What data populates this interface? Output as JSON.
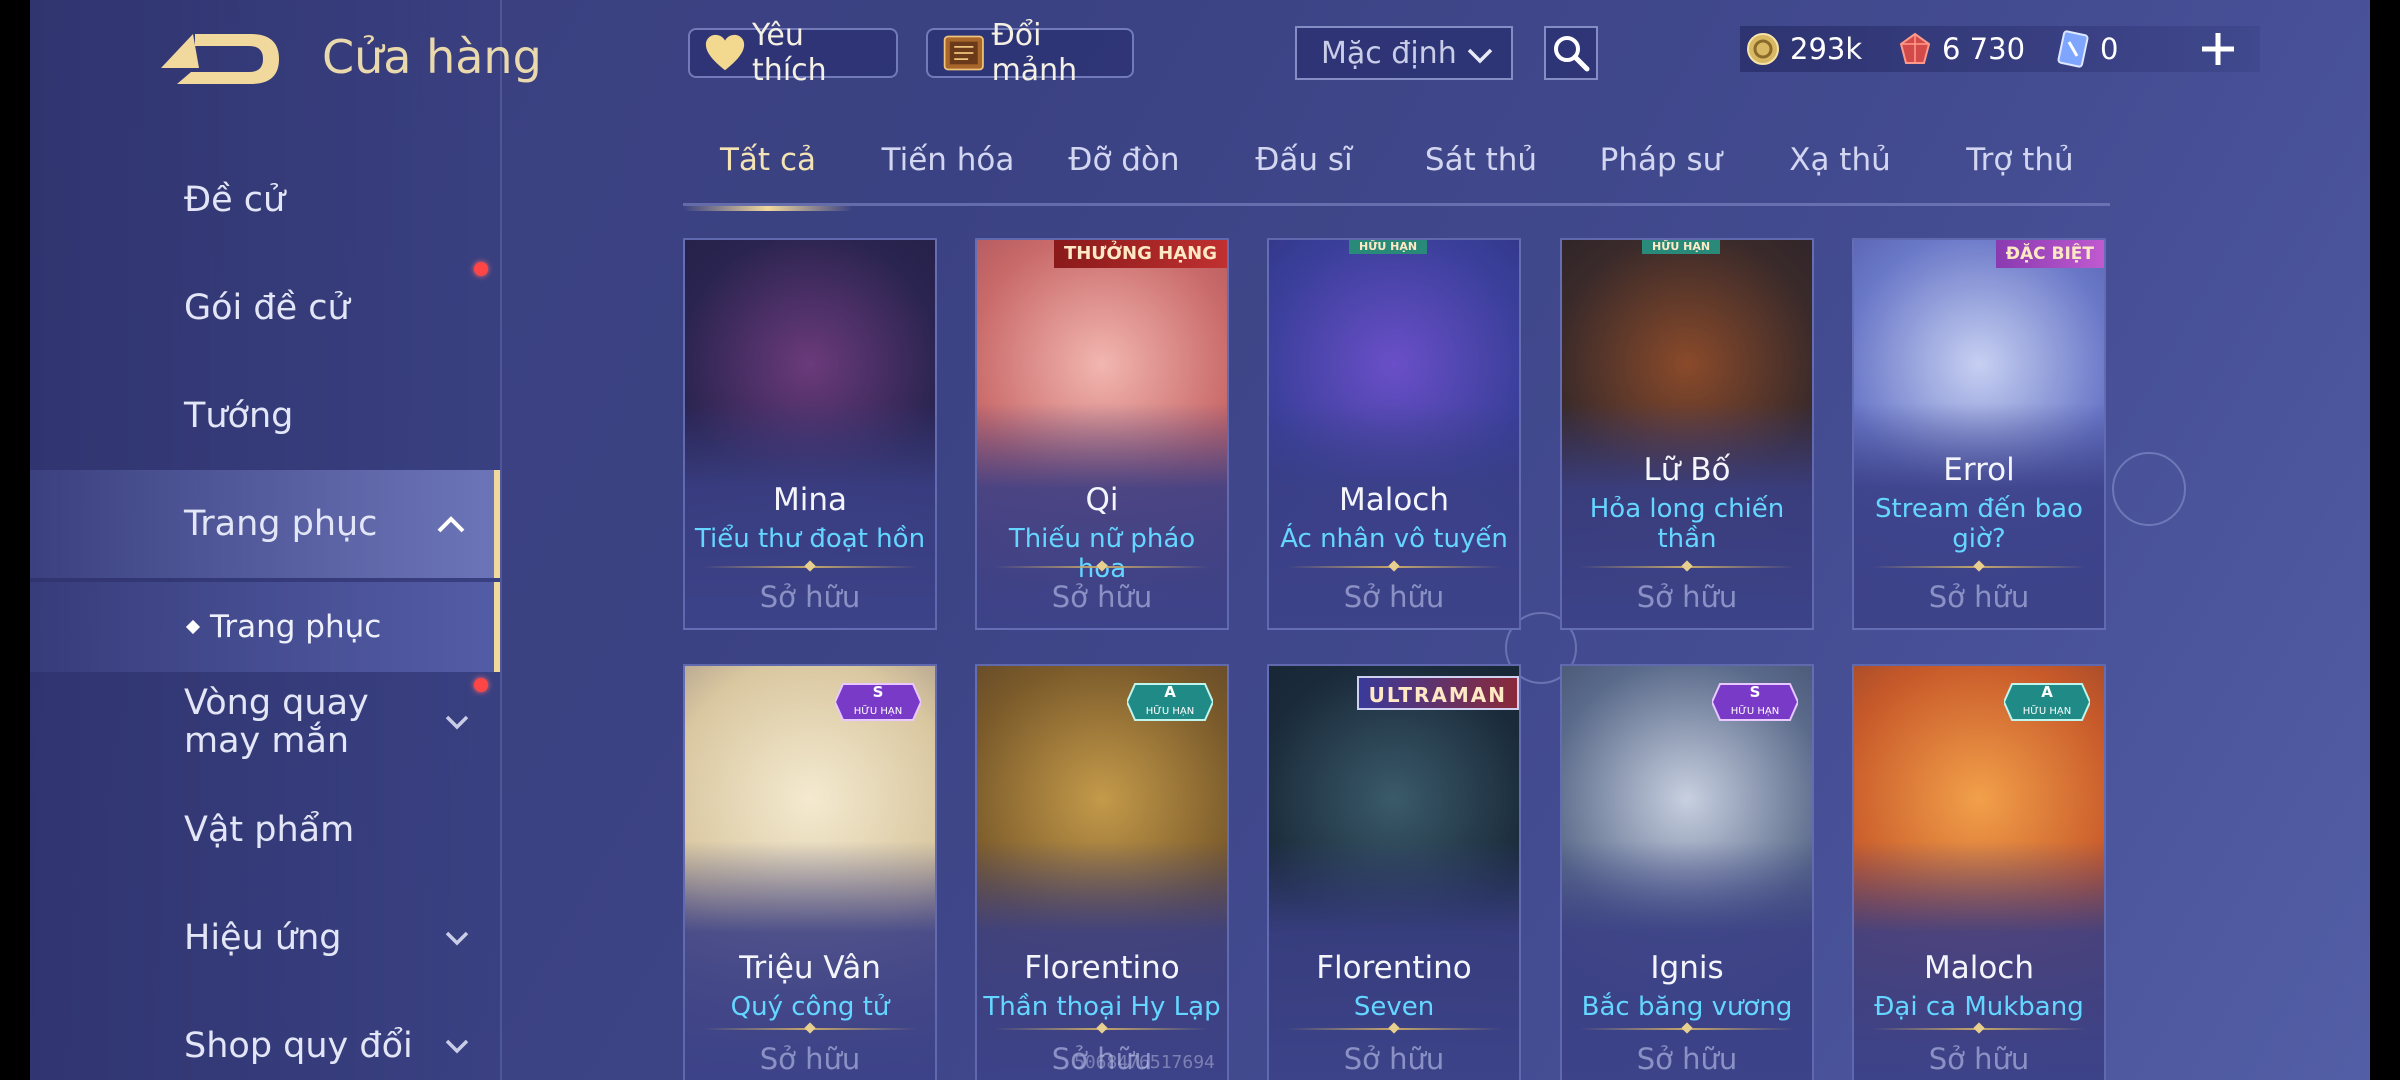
{
  "header": {
    "title": "Cửa hàng"
  },
  "toolbar": {
    "favorites_label": "Yêu thích",
    "exchange_label": "Đổi mảnh",
    "sort_selected": "Mặc định"
  },
  "currencies": [
    {
      "value": "293k",
      "icon": "gold-coin-icon"
    },
    {
      "value": "6 730",
      "icon": "ruby-icon"
    },
    {
      "value": "0",
      "icon": "voucher-card-icon"
    }
  ],
  "sidebar": {
    "items": [
      {
        "label": "Đề cử"
      },
      {
        "label": "Gói đề cử"
      },
      {
        "label": "Tướng"
      },
      {
        "label": "Trang phục"
      },
      {
        "label": "Trang phục"
      },
      {
        "label": "Vòng quay may mắn"
      },
      {
        "label": "Vật phẩm"
      },
      {
        "label": "Hiệu ứng"
      },
      {
        "label": "Shop quy đổi"
      }
    ]
  },
  "tabs": [
    {
      "label": "Tất cả"
    },
    {
      "label": "Tiến hóa"
    },
    {
      "label": "Đỡ đòn"
    },
    {
      "label": "Đấu sĩ"
    },
    {
      "label": "Sát thủ"
    },
    {
      "label": "Pháp sư"
    },
    {
      "label": "Xạ thủ"
    },
    {
      "label": "Trợ thủ"
    }
  ],
  "cards": [
    {
      "hero": "Mina",
      "skin": "Tiểu thư đoạt hồn",
      "status": "Sở hữu",
      "badge": "",
      "colors": [
        "#2a2450",
        "#6b3a7a",
        "#1c1a3a"
      ]
    },
    {
      "hero": "Qi",
      "skin": "Thiếu nữ pháo hoa",
      "status": "Sở hữu",
      "badge": "THƯỞNG HẠNG",
      "colors": [
        "#c96a6a",
        "#f2b6b0",
        "#8a3a4a"
      ]
    },
    {
      "hero": "Maloch",
      "skin": "Ác nhân vô tuyến",
      "status": "Sở hữu",
      "badge": "HỮU HẠN",
      "colors": [
        "#3a3f9a",
        "#6a4fc8",
        "#24286a"
      ]
    },
    {
      "hero": "Lữ Bố",
      "skin": "Hỏa long chiến thần",
      "status": "Sở hữu",
      "badge": "HỮU HẠN",
      "colors": [
        "#3a2a2a",
        "#8a4a2a",
        "#1a1a2a"
      ]
    },
    {
      "hero": "Errol",
      "skin": "Stream đến bao giờ?",
      "status": "Sở hữu",
      "badge": "ĐẶC BIỆT",
      "colors": [
        "#6a78c8",
        "#c7d0f2",
        "#3a3f8a"
      ]
    },
    {
      "hero": "Triệu Vân",
      "skin": "Quý công tử",
      "status": "Sở hữu",
      "rank": "S",
      "colors": [
        "#d9c7a0",
        "#f4ead0",
        "#6a5a70"
      ]
    },
    {
      "hero": "Florentino",
      "skin": "Thần thoại Hy Lạp",
      "status": "Sở hữu",
      "rank": "A",
      "colors": [
        "#7a5a2a",
        "#c49a4a",
        "#3a2a2a"
      ]
    },
    {
      "hero": "Florentino",
      "skin": "Seven",
      "status": "Sở hữu",
      "badge": "ULTRAMAN",
      "colors": [
        "#1a2a3a",
        "#3a5a6a",
        "#12202c"
      ]
    },
    {
      "hero": "Ignis",
      "skin": "Bắc băng vương",
      "status": "Sở hữu",
      "rank": "S",
      "colors": [
        "#5a6a8a",
        "#c8d0e0",
        "#2a3050"
      ]
    },
    {
      "hero": "Maloch",
      "skin": "Đại ca Mukbang",
      "status": "Sở hữu",
      "rank": "A",
      "colors": [
        "#c85a2a",
        "#f2a04a",
        "#5a2a2a"
      ]
    }
  ],
  "rank_label": "HỮU HẠN",
  "watermark": "5068476517694"
}
